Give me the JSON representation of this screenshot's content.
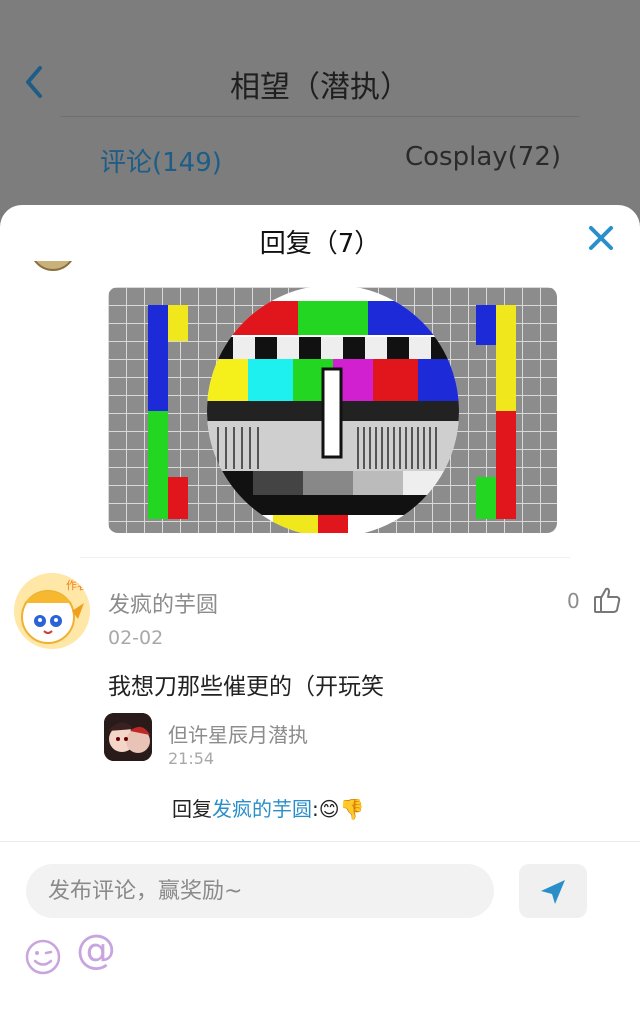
{
  "header": {
    "title": "相望（潜执）",
    "tabs": [
      {
        "label": "评论(149)",
        "active": true
      },
      {
        "label": "Cosplay(72)",
        "active": false
      }
    ]
  },
  "sheet": {
    "title": "回复（7）"
  },
  "comment": {
    "author": "发疯的芋圆",
    "date": "02-02",
    "like_count": "0",
    "text": "我想刀那些催更的（开玩笑",
    "avatar_badge": "作者"
  },
  "reply": {
    "author": "但许星辰月潜执",
    "time": "21:54",
    "prefix": "回复",
    "mention": "发疯的芋圆",
    "suffix": ":😊👎"
  },
  "composer": {
    "placeholder": "发布评论，赢奖励~",
    "at_symbol": "@"
  },
  "colors": {
    "accent": "#2a8fc9",
    "icon_purple": "#c9a5df"
  },
  "icons": [
    "back-arrow-icon",
    "close-icon",
    "thumbs-up-icon",
    "send-icon",
    "emoji-icon"
  ]
}
